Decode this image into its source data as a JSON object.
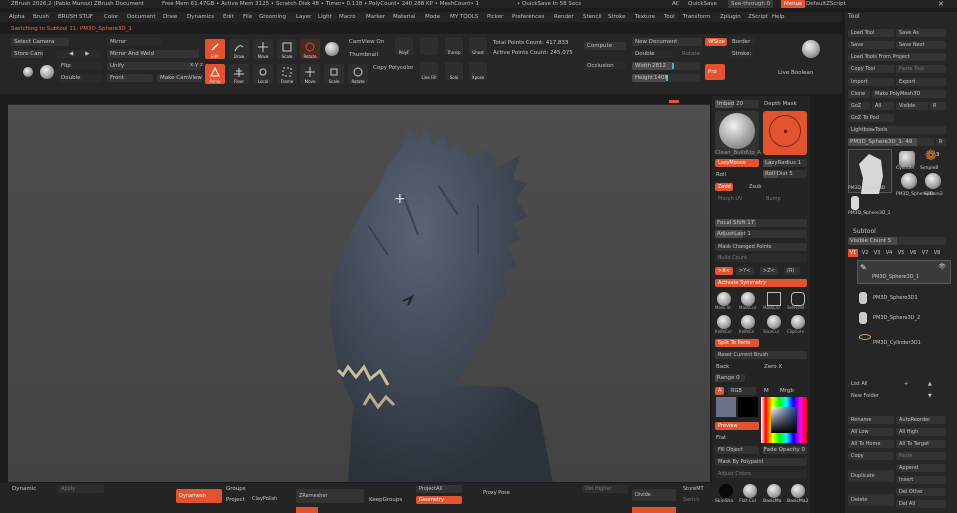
{
  "titlebar": {
    "app": "ZBrush 2026.2 (Pablo Munoz)  ZBrush Document",
    "stats": "Free Mem 61.47GB • Active Mem 3125 • Scratch Disk 48 • Timer• 0.118 • PolyCount• 240.288 KP • MeshCount• 1",
    "quicksave": "• QuickSave In 58 Secs",
    "ac": "AC",
    "quicksave_btn": "QuickSave",
    "see_through": "See-through  0",
    "menus_btn": "Menus",
    "default_script": "DefaultZScript"
  },
  "menubar": [
    "Alpha",
    "Brush",
    "BRUSH STUF",
    "Color",
    "Document",
    "Draw",
    "Dynamics",
    "Edit",
    "File",
    "Grooming",
    "Layer",
    "Light",
    "Macro",
    "Marker",
    "Material",
    "Mode",
    "MY TOOLS",
    "Picker",
    "Preferences",
    "Render",
    "Stencil",
    "Stroke",
    "Texture",
    "Tool",
    "Transform",
    "Zplugin",
    "ZScript",
    "Help"
  ],
  "notice": "Switching to Subtool 11: PM3D_Sphere3D_1",
  "toolbar": {
    "select_camera": "Select Camera",
    "mirror": "Mirror",
    "store_cam": "Store Cam",
    "mirror_and_weld": "Mirror And Weld",
    "flip": "Flip",
    "unify": "Unify",
    "double": "Double",
    "front": "Front",
    "make_cam_view": "Make CamView",
    "xyz": "x y z",
    "edit": "Edit",
    "draw": "Draw",
    "move": "Move",
    "scale": "Scale",
    "rotate": "Rotate",
    "persp": "Persp",
    "floor": "Floor",
    "local": "Local",
    "frame": "Frame",
    "move2": "Move",
    "scale2": "Scale",
    "rotate2": "Rotate",
    "cam_view_on": "CamView On",
    "thumbnail": "Thumbnail",
    "copy_polycolor": "Copy Polycolor",
    "line_fill": "Line Fill",
    "poly_f": "PolyF",
    "transp": "Transp",
    "solo": "Solo",
    "ghost": "Ghost",
    "xpose": "Xpose",
    "dynamic": "Dynamic",
    "total_points": "Total Points Count: 417,833",
    "active_points": "Active Points Count: 245,075",
    "compute": "Compute",
    "occlusion": "Occlusion",
    "new_document": "New Document",
    "wsize": "WSize",
    "border": "Border",
    "double2": "Double",
    "rotate_label": "Rotate",
    "width_label": "Width",
    "width_value": "2812",
    "height_label": "Height",
    "height_value": "1406",
    "pro": "Pro",
    "stroke": "Stroke: 4",
    "matcap": "Matl",
    "live_boolean": "Live Boolean"
  },
  "midpanel": {
    "imbed": "Imbed 20",
    "depth_mask": "Depth Mask",
    "brush_name": "Clean_BuildUp_A",
    "lazy_mouse": "LazyMouse",
    "lazy_radius": "LazyRadius 1",
    "roll": "Roll",
    "roll_dist": "Roll Dist 5",
    "zadd": "Zadd",
    "zsub": "Zsub",
    "morph_uv": "Morph UV",
    "bump": "Bump",
    "focal_shift": "Focal Shift 17",
    "adjust_last": "AdjustLast 1",
    "mask_changed_points": "Mask Changed Points",
    "build_count": "Build Count",
    "sym_x": ">X<",
    "sym_y": ">Y<",
    "sym_z": ">Z<",
    "sym_r": "(R)",
    "activate_symmetry": "Activate Symmetry",
    "brush_labels": [
      "Mask St",
      "MaskCur",
      "MaskLas",
      "SelectRe"
    ],
    "brush_labels2": [
      "KnifeCur",
      "KnifeCir",
      "SliceCur",
      "ClipCurv"
    ],
    "split_to_parts": "Split To Parts",
    "reset_current_brush": "Reset Current Brush",
    "back": "Back",
    "zero_x": "Zero X",
    "range": "Range 0",
    "a_label": "A",
    "rgb": "RGB",
    "m_label": "M",
    "mrgb": "Mrgb",
    "preview": "Preview",
    "flat": "Flat",
    "fill_object": "Fill Object",
    "fade_opacity": "Fade Opacity 0",
    "mask_by_polypaint": "Mask By Polypaint",
    "adjust_colors": "Adjust Colors",
    "material_labels": [
      "SkinSha",
      "Flat Col",
      "BasicMa",
      "BasicMa2"
    ]
  },
  "rightpanel": {
    "title": "Tool",
    "load_tool": "Load Tool",
    "save_as": "Save As",
    "save": "Save",
    "save_next": "Save Next",
    "load_tools_from_project": "Load Tools From Project",
    "copy_tool": "Copy Tool",
    "paste_tool": "Paste Tool",
    "import": "Import",
    "export": "Export",
    "clone": "Clone",
    "make_polymesh": "Make PolyMesh3D",
    "goz": "GoZ",
    "all": "All",
    "visible": "Visible",
    "r": "R",
    "goz_to_pod": "GoZ To Pod",
    "lightbox_tools": "Lightbox▸Tools",
    "current_tool": "PM3D_Sphere3D_1. 49",
    "r2": "R",
    "count_badge": "3",
    "thumb_labels": [
      "PM3D_Sphere3D",
      "Cylinder",
      "SimpleB",
      "PM3D_Sphere3D",
      "Sphere3"
    ],
    "thumb_small": "PM3D_Sphere3D_1",
    "subtool": "Subtool",
    "visible_count": "Visible Count 5",
    "vbuttons": [
      "V1",
      "V2",
      "V3",
      "V4",
      "V5",
      "V6",
      "V7",
      "V8"
    ],
    "subtools": [
      "PM3D_Sphere3D_1",
      "PM3D_Sphere3D1",
      "PM3D_Sphere3D_2",
      "PM3D_Cylinder3D1"
    ],
    "list_all": "List All",
    "new_folder": "New Folder",
    "rename": "Rename",
    "autoreorder": "AutoReorder",
    "all_low": "All Low",
    "all_high": "All High",
    "all_to_home": "All To Home",
    "all_to_target": "All To Target",
    "copy": "Copy",
    "paste": "Paste",
    "duplicate": "Duplicate",
    "append": "Append",
    "insert": "Insert",
    "delete": "Delete",
    "del_other": "Del Other",
    "del_all": "Del All"
  },
  "bottombar": {
    "dynamic": "Dynamic",
    "apply": "Apply",
    "dynamesh": "Dynamesh",
    "groups": "Groups",
    "project": "Project",
    "claypolish": "ClayPolish",
    "zremesher": "ZRemesher",
    "keepgroups": "KeepGroups",
    "projectall": "ProjectAll",
    "geometry": "Geometry",
    "proxy_pose": "Proxy Pose",
    "del_higher": "Del Higher",
    "divide": "Divide",
    "storemt": "StoreMT",
    "switch": "Switch"
  },
  "colors": {
    "accent": "#e4532f",
    "panel": "#242424",
    "viewport": "#4a4a4a",
    "highlight": "#3cb2d6"
  }
}
